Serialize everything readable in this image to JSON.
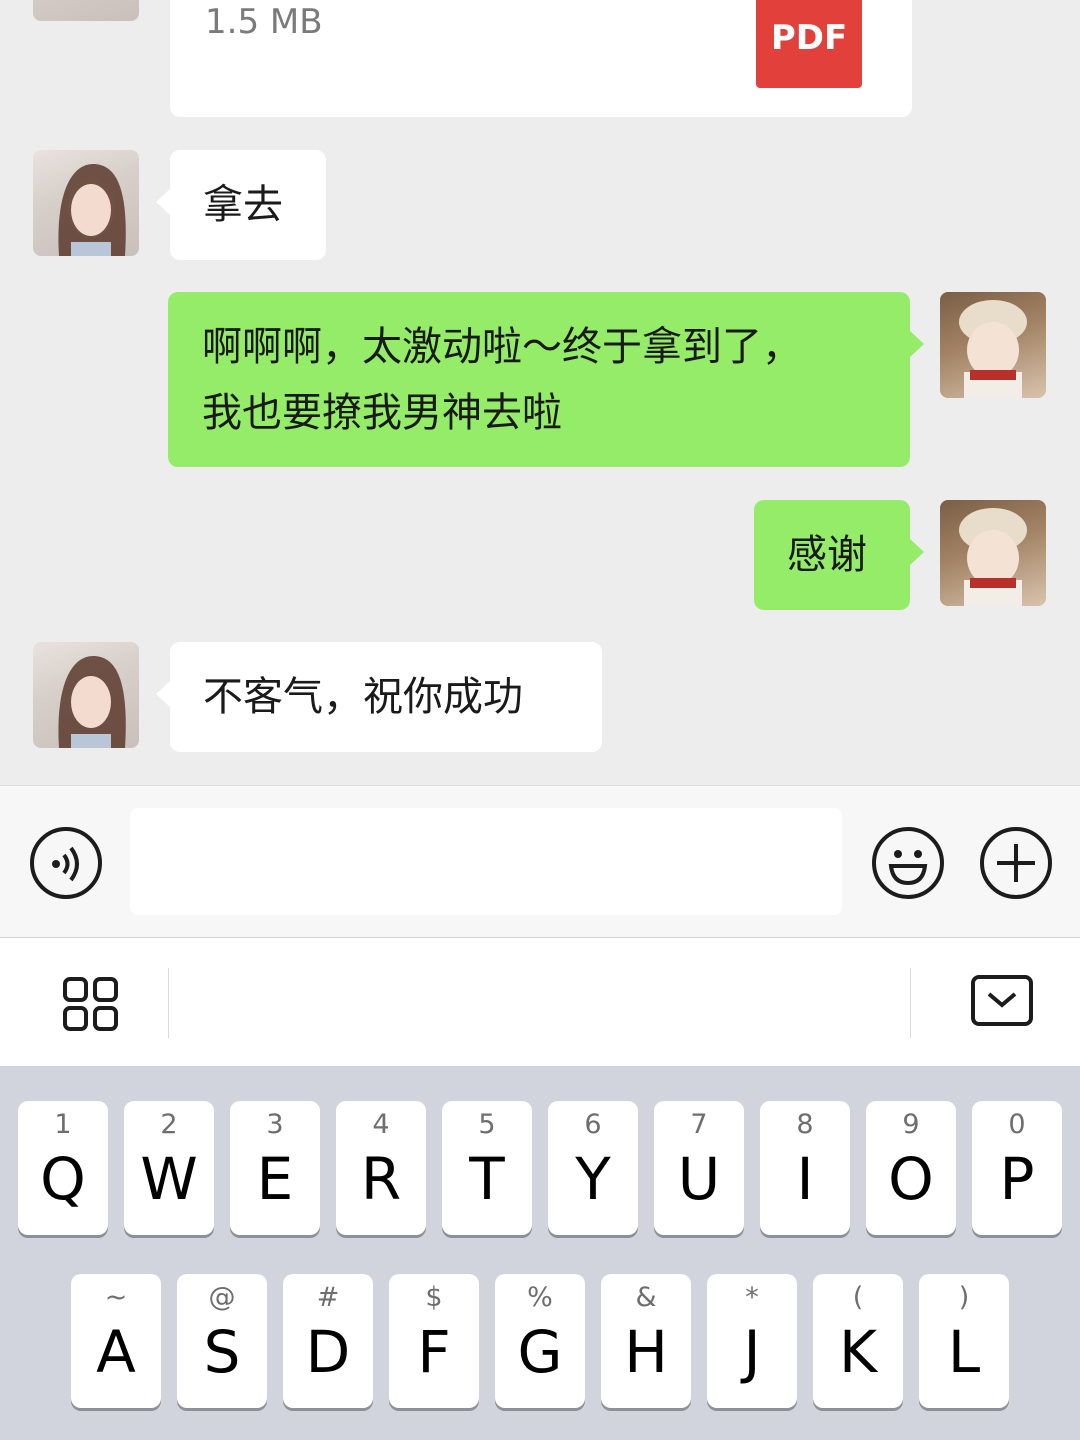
{
  "file": {
    "size": "1.5 MB",
    "badge": "PDF"
  },
  "messages": [
    {
      "side": "in",
      "text": "拿去"
    },
    {
      "side": "out",
      "line1": "啊啊啊，太激动啦～终于拿到了，",
      "line2": "我也要撩我男神去啦"
    },
    {
      "side": "out",
      "text": "感谢"
    },
    {
      "side": "in",
      "text": "不客气，祝你成功"
    }
  ],
  "input": {
    "placeholder": ""
  },
  "keyboard": {
    "row1": [
      {
        "sub": "1",
        "main": "Q"
      },
      {
        "sub": "2",
        "main": "W"
      },
      {
        "sub": "3",
        "main": "E"
      },
      {
        "sub": "4",
        "main": "R"
      },
      {
        "sub": "5",
        "main": "T"
      },
      {
        "sub": "6",
        "main": "Y"
      },
      {
        "sub": "7",
        "main": "U"
      },
      {
        "sub": "8",
        "main": "I"
      },
      {
        "sub": "9",
        "main": "O"
      },
      {
        "sub": "0",
        "main": "P"
      }
    ],
    "row2": [
      {
        "sub": "~",
        "main": "A"
      },
      {
        "sub": "@",
        "main": "S"
      },
      {
        "sub": "#",
        "main": "D"
      },
      {
        "sub": "$",
        "main": "F"
      },
      {
        "sub": "%",
        "main": "G"
      },
      {
        "sub": "&",
        "main": "H"
      },
      {
        "sub": "*",
        "main": "J"
      },
      {
        "sub": "(",
        "main": "K"
      },
      {
        "sub": ")",
        "main": "L"
      }
    ]
  },
  "icons": {
    "voice": "voice-icon",
    "emoji": "emoji-icon",
    "more": "plus-icon",
    "ime_menu": "grid-menu-icon",
    "hide_keyboard": "keyboard-hide-icon"
  },
  "colors": {
    "chat_bg": "#ededed",
    "outgoing_bubble": "#95ec69",
    "incoming_bubble": "#ffffff",
    "pdf_badge": "#e2403a",
    "keyboard_bg": "#d1d4dc"
  }
}
